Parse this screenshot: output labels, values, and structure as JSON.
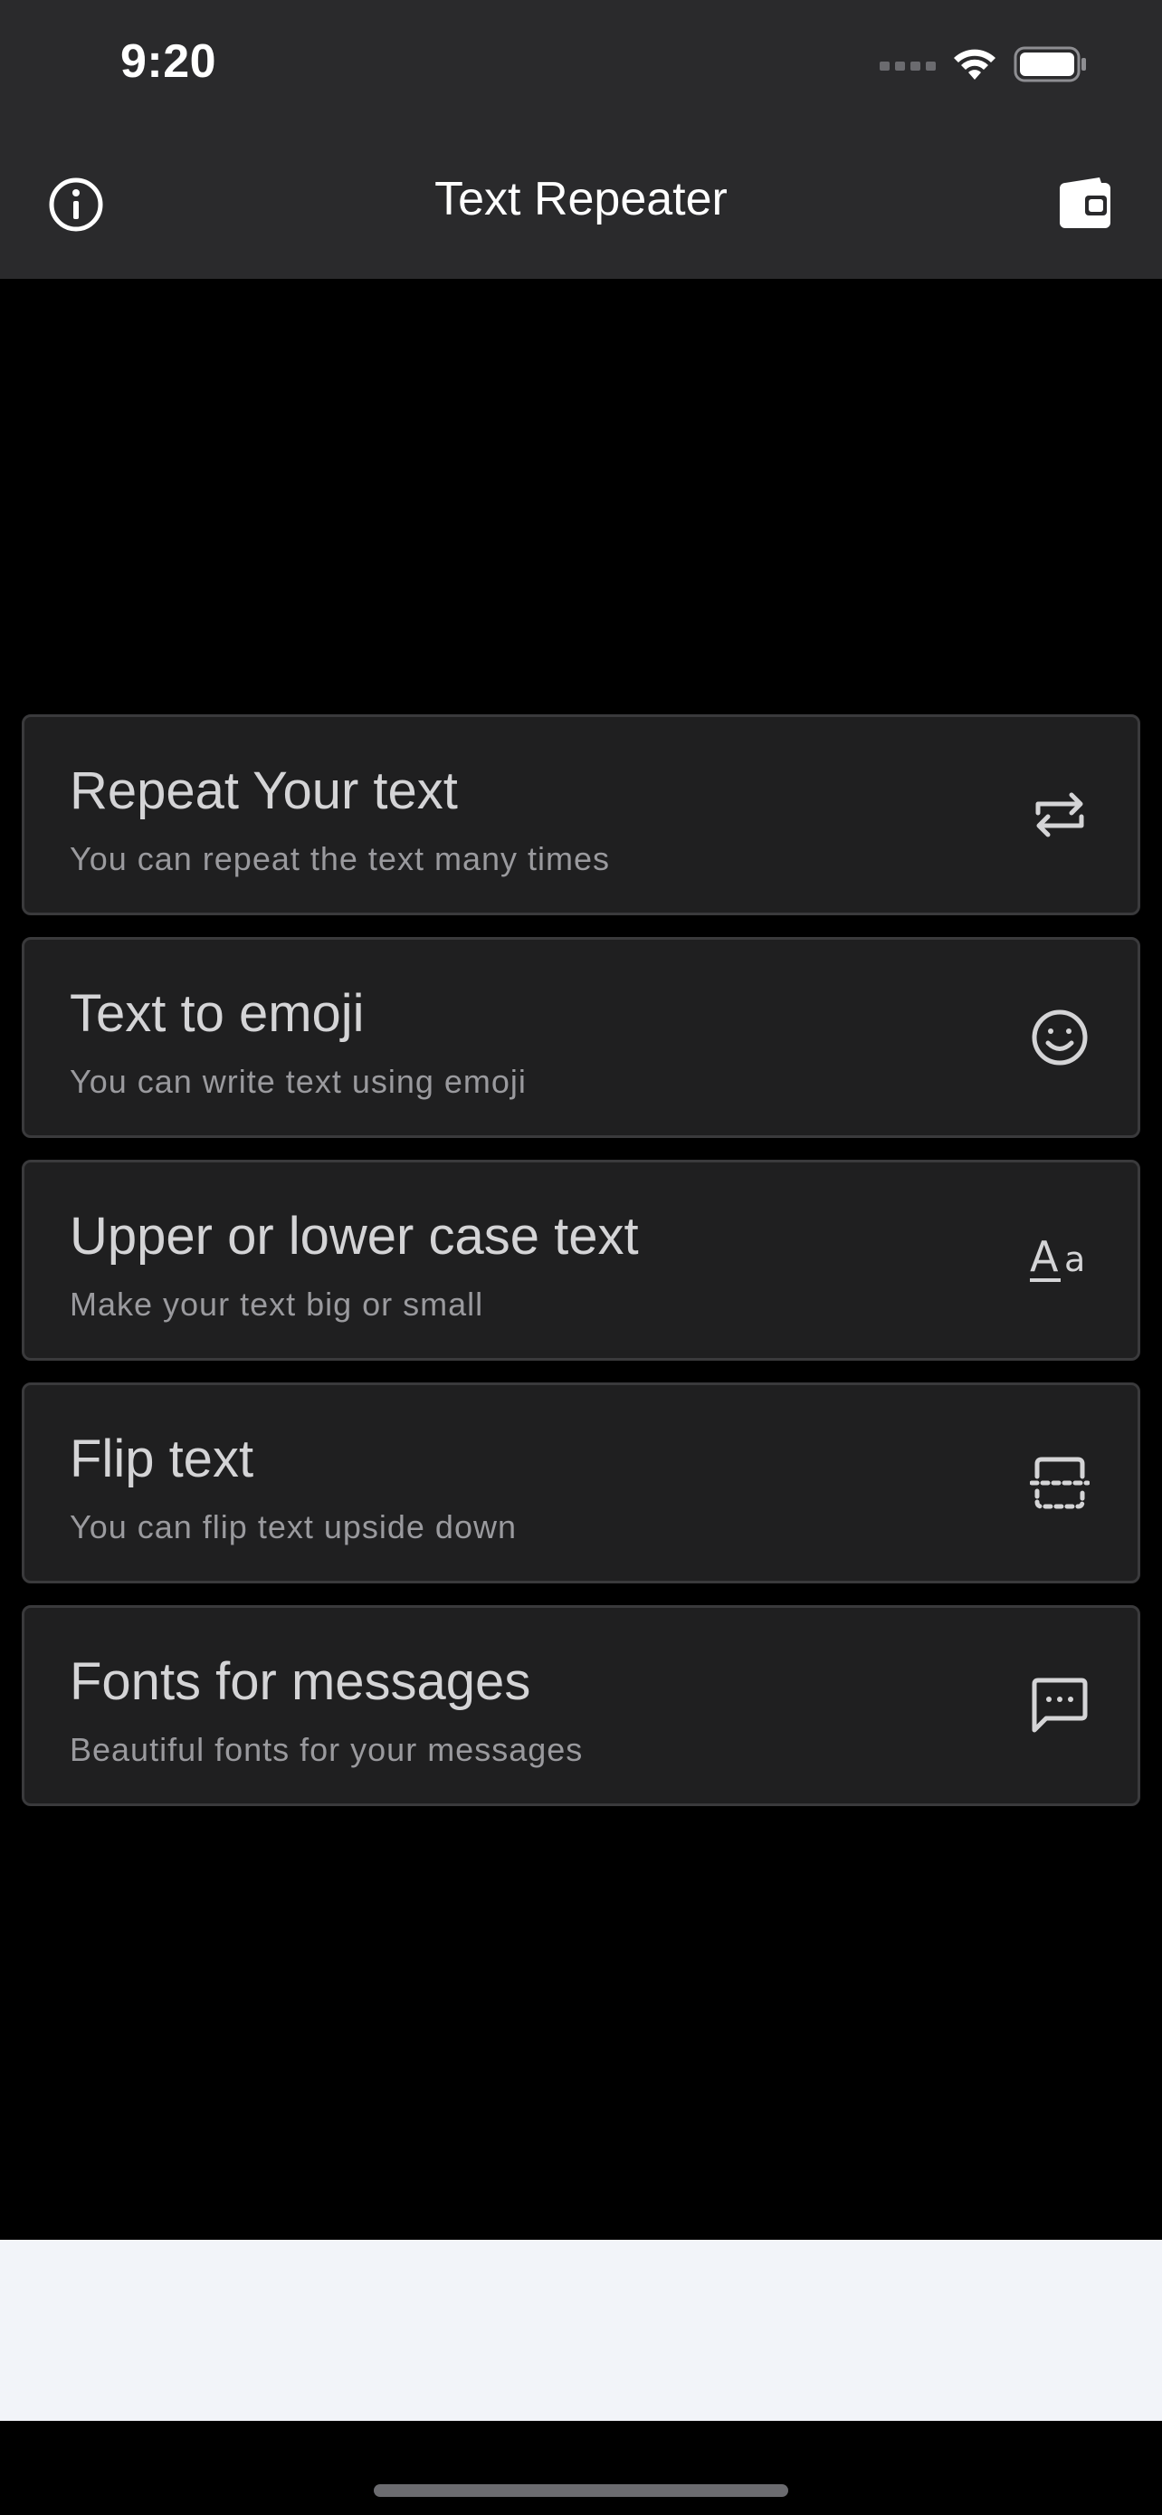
{
  "status_bar": {
    "time": "9:20"
  },
  "nav": {
    "title": "Text Repeater",
    "left_icon": "info-icon",
    "right_icon": "wallet-icon"
  },
  "cards": [
    {
      "title": "Repeat Your text",
      "subtitle": "You can repeat the text many times",
      "icon": "repeat-icon"
    },
    {
      "title": "Text to emoji",
      "subtitle": "You can write text using emoji",
      "icon": "smiley-icon"
    },
    {
      "title": "Upper or lower case text",
      "subtitle": "Make your text big or small",
      "icon": "text-case-icon",
      "icon_glyph_upper": "A",
      "icon_glyph_lower": "a"
    },
    {
      "title": "Flip text",
      "subtitle": "You can flip text upside down",
      "icon": "flip-icon"
    },
    {
      "title": "Fonts for messages",
      "subtitle": "Beautiful fonts for your messages",
      "icon": "message-icon"
    }
  ],
  "colors": {
    "background": "#000000",
    "bar": "#2a2a2c",
    "card": "#1f1f20",
    "card_border": "#3a3a3c",
    "title_text": "#d4d4d6",
    "subtitle_text": "#9a9a9e",
    "ad_area": "#f2f4f9"
  }
}
